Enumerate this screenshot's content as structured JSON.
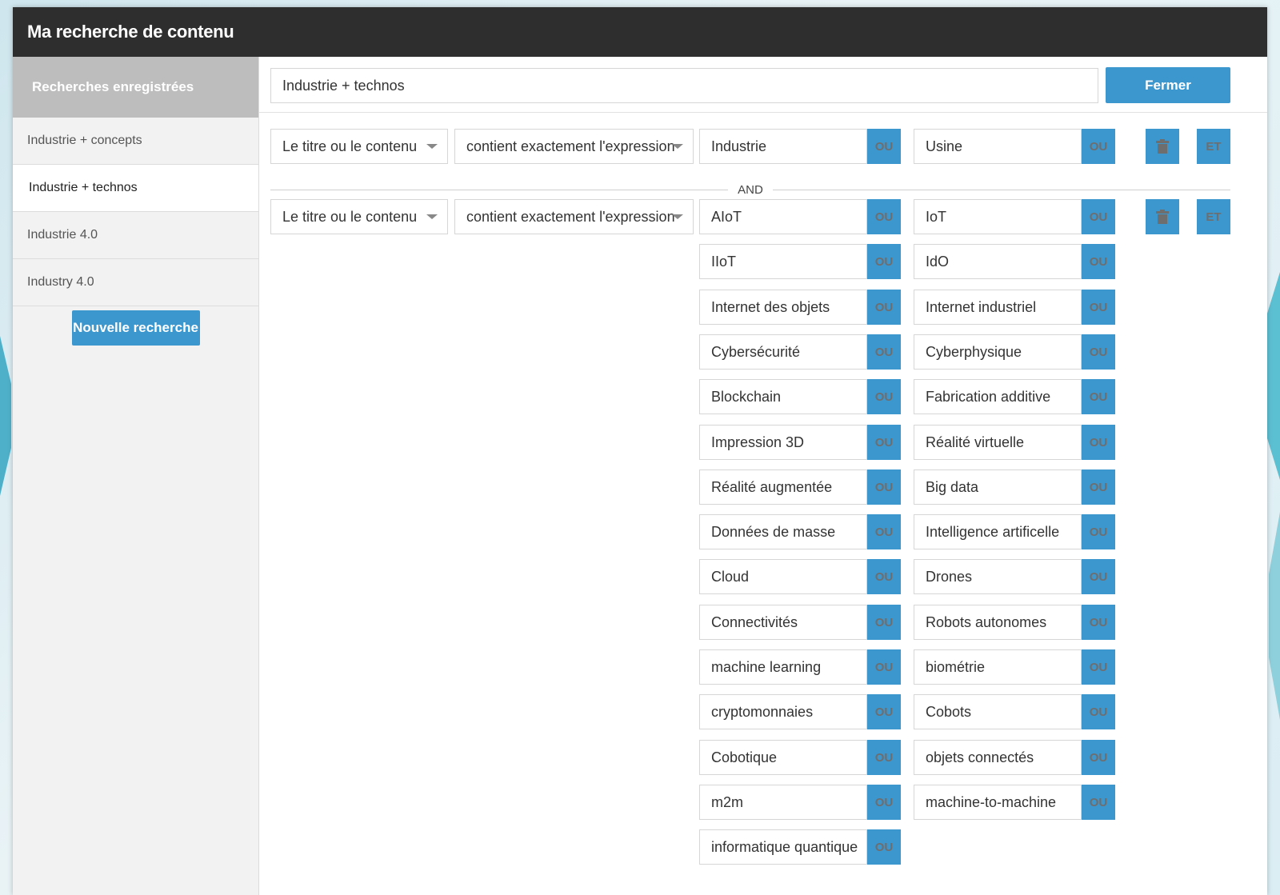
{
  "window": {
    "title": "Ma recherche de contenu"
  },
  "sidebar": {
    "header": "Recherches enregistrées",
    "items": [
      {
        "label": "Industrie + concepts",
        "active": false
      },
      {
        "label": "Industrie + technos",
        "active": true
      },
      {
        "label": "Industrie 4.0",
        "active": false
      },
      {
        "label": "Industry 4.0",
        "active": false
      }
    ],
    "new_button": "Nouvelle recherche"
  },
  "topbar": {
    "search_name_value": "Industrie + technos",
    "close_button": "Fermer"
  },
  "groups": [
    {
      "field_select": "Le titre ou le contenu",
      "operator_select": "contient exactement l'expression",
      "terms": [
        "Industrie",
        "Usine"
      ]
    },
    {
      "field_select": "Le titre ou le contenu",
      "operator_select": "contient exactement l'expression",
      "terms": [
        "AIoT",
        "IoT",
        "IIoT",
        "IdO",
        "Internet des objets",
        "Internet industriel",
        "Cybersécurité",
        "Cyberphysique",
        "Blockchain",
        "Fabrication additive",
        "Impression 3D",
        "Réalité virtuelle",
        "Réalité augmentée",
        "Big data",
        "Données de masse",
        "Intelligence artificelle",
        "Cloud",
        "Drones",
        "Connectivités",
        "Robots autonomes",
        "machine learning",
        "biométrie",
        "cryptomonnaies",
        "Cobots",
        "Cobotique",
        "objets connectés",
        "m2m",
        "machine-to-machine",
        "informatique quantique"
      ]
    }
  ],
  "labels": {
    "or_button": "OU",
    "and_button": "ET",
    "and_separator": "AND"
  },
  "colors": {
    "header_bg": "#2e2e2e",
    "accent": "#3d97cf",
    "sidebar_header_bg": "#bdbdbd"
  }
}
